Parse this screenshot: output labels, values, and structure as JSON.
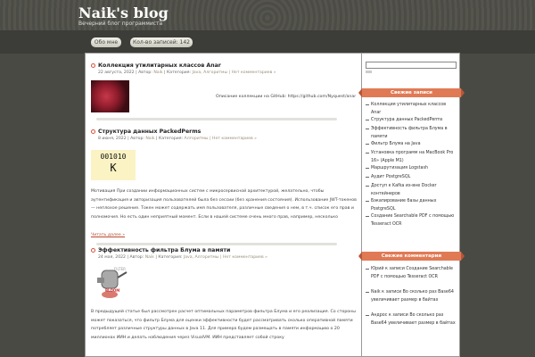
{
  "site": {
    "title": "Naik's blog",
    "tagline": "Вечерний блог программиста"
  },
  "nav": {
    "about": "Обо мне",
    "count": "Кол-во записей: 142"
  },
  "posts": [
    {
      "title": "Коллекция утилитарных классов Anar",
      "date": "22 августа, 2022",
      "author_prefix": "| Автор:",
      "author": "Naik",
      "cat_prefix": "| Категория:",
      "categories": "Java, Алгоритмы",
      "comments": "| Нет комментариев »",
      "text": "Описание коллекции на GitHub: https://github.com/Nyquest/anar"
    },
    {
      "title": "Структура данных PackedPerms",
      "date": "8 июня, 2022",
      "author_prefix": "| Автор:",
      "author": "Naik",
      "cat_prefix": "| Категория:",
      "categories": "Алгоритмы",
      "comments": "| Нет комментариев »",
      "img_line1": "001010",
      "img_line2": "K",
      "text": "Мотивация При создании информационных систем с микросервисной архитектурой, желательно, чтобы аутентификация и авторизация пользователей была без сессии (без хранения состояния). Использование JWT-токенов — неплохое решение. Токен может содержать имя пользователя, различные сведения о нем, в т.ч. список его прав и полномочия. Но есть один неприятный момент. Если в нашей системе очень много прав, например, несколько",
      "readmore": "Читать далее »"
    },
    {
      "title": "Эффективность фильтра Блума в памяти",
      "date": "24 мая, 2022",
      "author_prefix": "| Автор:",
      "author": "Naik",
      "cat_prefix": "| Категория:",
      "categories": "Java, Алгоритмы",
      "comments": "| Нет комментариев »",
      "img_label": "FILTER",
      "img_label2": "BLOOM",
      "text": "В предыдущей статье был рассмотрен расчет оптимальных параметров фильтра Блума и его реализация. Со стороны может показаться, что фильтр Блума для оценки эффективности будет рассматривать сколько оперативной памяти потребляет различные структуры данных в Java 11. Для примера будем размещать в памяти информацию о 20 миллионах ИИН и делать наблюдения через VisualVM. ИИН представляет собой строку"
    }
  ],
  "sidebar": {
    "recent_title": "Свежие записи",
    "recent": [
      "Коллекция утилитарных классов Anar",
      "Структура данных PackedPerms",
      "Эффективность фильтра Блума в памяти",
      "Фильтр Блума на Java",
      "Установка программ на MacBook Pro 16» (Apple M1)",
      "Маршрутизация Logstash",
      "Аудит PostgreSQL",
      "Доступ к Kafka из-вне Docker контейнеров",
      "Бэкапирование базы данных PostgreSQL",
      "Создание Searchable PDF с помощью Tesseract OCR"
    ],
    "comments_title": "Свежие комментарии",
    "comments": [
      "Юрий к записи Создание Searchable PDF с помощью Tesseract OCR",
      "Naik к записи Во сколько раз Base64 увеличивает размер в байтах",
      "Андрос к записи Во сколько раз Base64 увеличивает размер в байтах"
    ]
  },
  "colors": {
    "accent": "#e07a55",
    "bg": "#4a4a44"
  }
}
